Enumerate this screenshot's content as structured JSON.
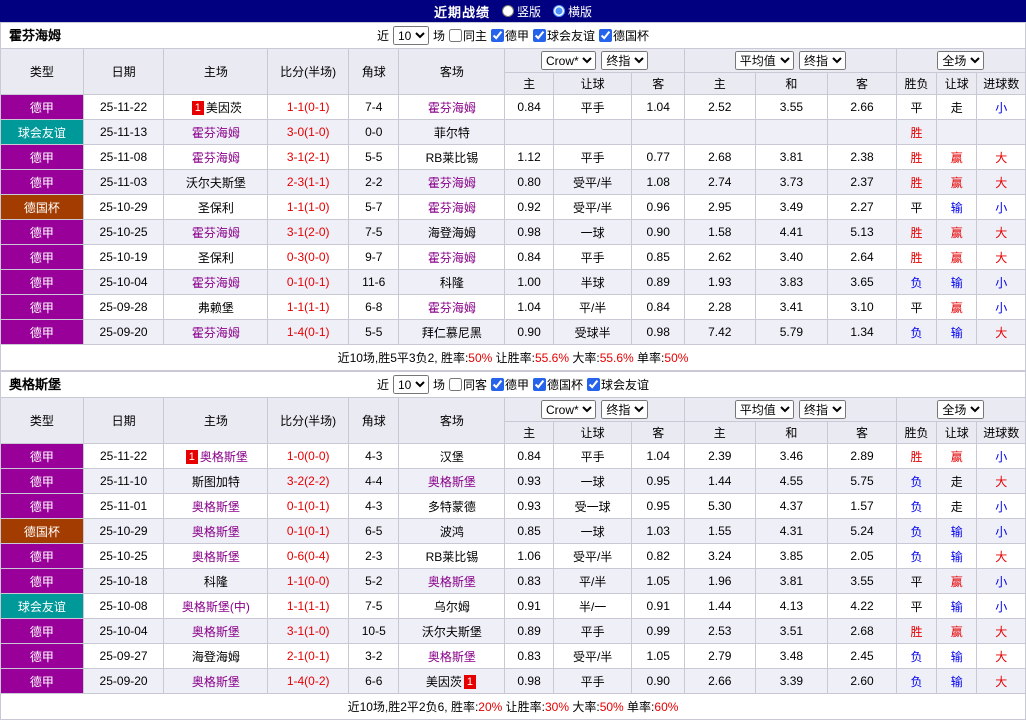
{
  "topbar": {
    "title": "近期战绩",
    "layout_options": [
      {
        "label": "竖版",
        "selected": false
      },
      {
        "label": "横版",
        "selected": true
      }
    ]
  },
  "table_header": {
    "type": "类型",
    "date": "日期",
    "home": "主场",
    "score": "比分(半场)",
    "corner": "角球",
    "away": "客场",
    "odds_selects": [
      "Crow*",
      "终指"
    ],
    "odds_home": "主",
    "odds_handicap": "让球",
    "odds_away": "客",
    "avg_selects": [
      "平均值",
      "终指"
    ],
    "avg_home": "主",
    "avg_draw": "和",
    "avg_away": "客",
    "result_select": "全场",
    "result_wl": "胜负",
    "result_handicap": "让球",
    "result_goals": "进球数"
  },
  "colors": {
    "topbar_bg": "#000080",
    "team_highlight": "#880088",
    "score_text": "#E60000",
    "positive": "#E60000",
    "negative": "#0000EE",
    "neutral": "#000000",
    "row_alt_bg": "#EFEFF8",
    "rank_badge_bg": "#E60000"
  },
  "league_colors": {
    "德甲": "#990099",
    "球会友谊": "#009999",
    "德国杯": "#A33C00"
  },
  "sections": [
    {
      "team": "霍芬海姆",
      "filter": {
        "prefix": "近",
        "count": "10",
        "suffix": "场",
        "same_venue": {
          "label": "同主",
          "checked": false
        },
        "leagues": [
          {
            "label": "德甲",
            "checked": true
          },
          {
            "label": "球会友谊",
            "checked": true
          },
          {
            "label": "德国杯",
            "checked": true
          }
        ]
      },
      "rows": [
        {
          "type": "德甲",
          "date": "25-11-22",
          "home": {
            "name": "美因茨",
            "rank": "1"
          },
          "score": "1-1(0-1)",
          "corner": "7-4",
          "away": {
            "name": "霍芬海姆",
            "hl": true
          },
          "odds": [
            "0.84",
            "平手",
            "1.04"
          ],
          "avg": [
            "2.52",
            "3.55",
            "2.66"
          ],
          "res": [
            "平",
            "走",
            "小"
          ]
        },
        {
          "type": "球会友谊",
          "date": "25-11-13",
          "home": {
            "name": "霍芬海姆",
            "hl": true
          },
          "score": "3-0(1-0)",
          "corner": "0-0",
          "away": {
            "name": "菲尔特"
          },
          "odds": [
            "",
            "",
            ""
          ],
          "avg": [
            "",
            "",
            ""
          ],
          "res": [
            "胜",
            "",
            ""
          ]
        },
        {
          "type": "德甲",
          "date": "25-11-08",
          "home": {
            "name": "霍芬海姆",
            "hl": true
          },
          "score": "3-1(2-1)",
          "corner": "5-5",
          "away": {
            "name": "RB莱比锡"
          },
          "odds": [
            "1.12",
            "平手",
            "0.77"
          ],
          "avg": [
            "2.68",
            "3.81",
            "2.38"
          ],
          "res": [
            "胜",
            "赢",
            "大"
          ]
        },
        {
          "type": "德甲",
          "date": "25-11-03",
          "home": {
            "name": "沃尔夫斯堡"
          },
          "score": "2-3(1-1)",
          "corner": "2-2",
          "away": {
            "name": "霍芬海姆",
            "hl": true
          },
          "odds": [
            "0.80",
            "受平/半",
            "1.08"
          ],
          "avg": [
            "2.74",
            "3.73",
            "2.37"
          ],
          "res": [
            "胜",
            "赢",
            "大"
          ]
        },
        {
          "type": "德国杯",
          "date": "25-10-29",
          "home": {
            "name": "圣保利"
          },
          "score": "1-1(1-0)",
          "corner": "5-7",
          "away": {
            "name": "霍芬海姆",
            "hl": true
          },
          "odds": [
            "0.92",
            "受平/半",
            "0.96"
          ],
          "avg": [
            "2.95",
            "3.49",
            "2.27"
          ],
          "res": [
            "平",
            "输",
            "小"
          ]
        },
        {
          "type": "德甲",
          "date": "25-10-25",
          "home": {
            "name": "霍芬海姆",
            "hl": true
          },
          "score": "3-1(2-0)",
          "corner": "7-5",
          "away": {
            "name": "海登海姆"
          },
          "odds": [
            "0.98",
            "一球",
            "0.90"
          ],
          "avg": [
            "1.58",
            "4.41",
            "5.13"
          ],
          "res": [
            "胜",
            "赢",
            "大"
          ]
        },
        {
          "type": "德甲",
          "date": "25-10-19",
          "home": {
            "name": "圣保利"
          },
          "score": "0-3(0-0)",
          "corner": "9-7",
          "away": {
            "name": "霍芬海姆",
            "hl": true
          },
          "odds": [
            "0.84",
            "平手",
            "0.85"
          ],
          "avg": [
            "2.62",
            "3.40",
            "2.64"
          ],
          "res": [
            "胜",
            "赢",
            "大"
          ]
        },
        {
          "type": "德甲",
          "date": "25-10-04",
          "home": {
            "name": "霍芬海姆",
            "hl": true
          },
          "score": "0-1(0-1)",
          "corner": "11-6",
          "away": {
            "name": "科隆"
          },
          "odds": [
            "1.00",
            "半球",
            "0.89"
          ],
          "avg": [
            "1.93",
            "3.83",
            "3.65"
          ],
          "res": [
            "负",
            "输",
            "小"
          ]
        },
        {
          "type": "德甲",
          "date": "25-09-28",
          "home": {
            "name": "弗赖堡"
          },
          "score": "1-1(1-1)",
          "corner": "6-8",
          "away": {
            "name": "霍芬海姆",
            "hl": true
          },
          "odds": [
            "1.04",
            "平/半",
            "0.84"
          ],
          "avg": [
            "2.28",
            "3.41",
            "3.10"
          ],
          "res": [
            "平",
            "赢",
            "小"
          ]
        },
        {
          "type": "德甲",
          "date": "25-09-20",
          "home": {
            "name": "霍芬海姆",
            "hl": true
          },
          "score": "1-4(0-1)",
          "corner": "5-5",
          "away": {
            "name": "拜仁慕尼黑"
          },
          "odds": [
            "0.90",
            "受球半",
            "0.98"
          ],
          "avg": [
            "7.42",
            "5.79",
            "1.34"
          ],
          "res": [
            "负",
            "输",
            "大"
          ]
        }
      ],
      "summary": {
        "prefix": "近10场,胜5平3负2, ",
        "stats": [
          {
            "label": "胜率:",
            "value": "50%"
          },
          {
            "label": " 让胜率:",
            "value": "55.6%"
          },
          {
            "label": " 大率:",
            "value": "55.6%"
          },
          {
            "label": " 单率:",
            "value": "50%"
          }
        ]
      }
    },
    {
      "team": "奥格斯堡",
      "filter": {
        "prefix": "近",
        "count": "10",
        "suffix": "场",
        "same_venue": {
          "label": "同客",
          "checked": false
        },
        "leagues": [
          {
            "label": "德甲",
            "checked": true
          },
          {
            "label": "德国杯",
            "checked": true
          },
          {
            "label": "球会友谊",
            "checked": true
          }
        ]
      },
      "rows": [
        {
          "type": "德甲",
          "date": "25-11-22",
          "home": {
            "name": "奥格斯堡",
            "rank": "1",
            "hl": true
          },
          "score": "1-0(0-0)",
          "corner": "4-3",
          "away": {
            "name": "汉堡"
          },
          "odds": [
            "0.84",
            "平手",
            "1.04"
          ],
          "avg": [
            "2.39",
            "3.46",
            "2.89"
          ],
          "res": [
            "胜",
            "赢",
            "小"
          ]
        },
        {
          "type": "德甲",
          "date": "25-11-10",
          "home": {
            "name": "斯图加特"
          },
          "score": "3-2(2-2)",
          "corner": "4-4",
          "away": {
            "name": "奥格斯堡",
            "hl": true
          },
          "odds": [
            "0.93",
            "一球",
            "0.95"
          ],
          "avg": [
            "1.44",
            "4.55",
            "5.75"
          ],
          "res": [
            "负",
            "走",
            "大"
          ]
        },
        {
          "type": "德甲",
          "date": "25-11-01",
          "home": {
            "name": "奥格斯堡",
            "hl": true
          },
          "score": "0-1(0-1)",
          "corner": "4-3",
          "away": {
            "name": "多特蒙德"
          },
          "odds": [
            "0.93",
            "受一球",
            "0.95"
          ],
          "avg": [
            "5.30",
            "4.37",
            "1.57"
          ],
          "res": [
            "负",
            "走",
            "小"
          ]
        },
        {
          "type": "德国杯",
          "date": "25-10-29",
          "home": {
            "name": "奥格斯堡",
            "hl": true
          },
          "score": "0-1(0-1)",
          "corner": "6-5",
          "away": {
            "name": "波鸿"
          },
          "odds": [
            "0.85",
            "一球",
            "1.03"
          ],
          "avg": [
            "1.55",
            "4.31",
            "5.24"
          ],
          "res": [
            "负",
            "输",
            "小"
          ]
        },
        {
          "type": "德甲",
          "date": "25-10-25",
          "home": {
            "name": "奥格斯堡",
            "hl": true
          },
          "score": "0-6(0-4)",
          "corner": "2-3",
          "away": {
            "name": "RB莱比锡"
          },
          "odds": [
            "1.06",
            "受平/半",
            "0.82"
          ],
          "avg": [
            "3.24",
            "3.85",
            "2.05"
          ],
          "res": [
            "负",
            "输",
            "大"
          ]
        },
        {
          "type": "德甲",
          "date": "25-10-18",
          "home": {
            "name": "科隆"
          },
          "score": "1-1(0-0)",
          "corner": "5-2",
          "away": {
            "name": "奥格斯堡",
            "hl": true
          },
          "odds": [
            "0.83",
            "平/半",
            "1.05"
          ],
          "avg": [
            "1.96",
            "3.81",
            "3.55"
          ],
          "res": [
            "平",
            "赢",
            "小"
          ]
        },
        {
          "type": "球会友谊",
          "date": "25-10-08",
          "home": {
            "name": "奥格斯堡(中)",
            "hl": true
          },
          "score": "1-1(1-1)",
          "corner": "7-5",
          "away": {
            "name": "乌尔姆"
          },
          "odds": [
            "0.91",
            "半/一",
            "0.91"
          ],
          "avg": [
            "1.44",
            "4.13",
            "4.22"
          ],
          "res": [
            "平",
            "输",
            "小"
          ]
        },
        {
          "type": "德甲",
          "date": "25-10-04",
          "home": {
            "name": "奥格斯堡",
            "hl": true
          },
          "score": "3-1(1-0)",
          "corner": "10-5",
          "away": {
            "name": "沃尔夫斯堡"
          },
          "odds": [
            "0.89",
            "平手",
            "0.99"
          ],
          "avg": [
            "2.53",
            "3.51",
            "2.68"
          ],
          "res": [
            "胜",
            "赢",
            "大"
          ]
        },
        {
          "type": "德甲",
          "date": "25-09-27",
          "home": {
            "name": "海登海姆"
          },
          "score": "2-1(0-1)",
          "corner": "3-2",
          "away": {
            "name": "奥格斯堡",
            "hl": true
          },
          "odds": [
            "0.83",
            "受平/半",
            "1.05"
          ],
          "avg": [
            "2.79",
            "3.48",
            "2.45"
          ],
          "res": [
            "负",
            "输",
            "大"
          ]
        },
        {
          "type": "德甲",
          "date": "25-09-20",
          "home": {
            "name": "奥格斯堡",
            "hl": true
          },
          "score": "1-4(0-2)",
          "corner": "6-6",
          "away": {
            "name": "美因茨",
            "rank": "1",
            "rank_after": true
          },
          "odds": [
            "0.98",
            "平手",
            "0.90"
          ],
          "avg": [
            "2.66",
            "3.39",
            "2.60"
          ],
          "res": [
            "负",
            "输",
            "大"
          ]
        }
      ],
      "summary": {
        "prefix": "近10场,胜2平2负6, ",
        "stats": [
          {
            "label": "胜率:",
            "value": "20%"
          },
          {
            "label": " 让胜率:",
            "value": "30%"
          },
          {
            "label": " 大率:",
            "value": "50%"
          },
          {
            "label": " 单率:",
            "value": "60%"
          }
        ]
      }
    }
  ]
}
